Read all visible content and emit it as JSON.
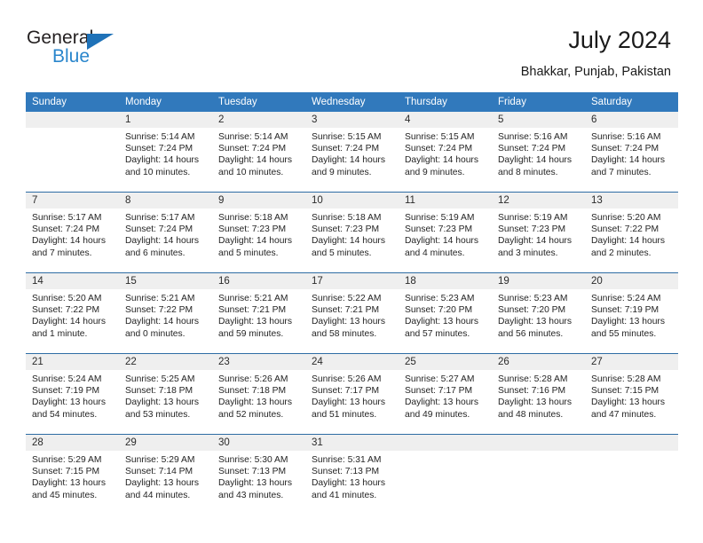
{
  "brand": {
    "line1": "General",
    "line2": "Blue",
    "triangle_color": "#1f72b8",
    "blue_text_color": "#2a86cc"
  },
  "header": {
    "title": "July 2024",
    "location": "Bhakkar, Punjab, Pakistan"
  },
  "theme": {
    "header_blue": "#3179bc",
    "row_separator_blue": "#2e6da4",
    "daynum_band_gray": "#efefef",
    "text_color": "#242424"
  },
  "weekdays": [
    "Sunday",
    "Monday",
    "Tuesday",
    "Wednesday",
    "Thursday",
    "Friday",
    "Saturday"
  ],
  "labels": {
    "sunrise_prefix": "Sunrise:",
    "sunset_prefix": "Sunset:",
    "daylight_prefix": "Daylight:"
  },
  "weeks": [
    [
      {
        "day": "",
        "sunrise": "",
        "sunset": "",
        "daylight_line1": "",
        "daylight_line2": ""
      },
      {
        "day": "1",
        "sunrise": "Sunrise: 5:14 AM",
        "sunset": "Sunset: 7:24 PM",
        "daylight_line1": "Daylight: 14 hours",
        "daylight_line2": "and 10 minutes."
      },
      {
        "day": "2",
        "sunrise": "Sunrise: 5:14 AM",
        "sunset": "Sunset: 7:24 PM",
        "daylight_line1": "Daylight: 14 hours",
        "daylight_line2": "and 10 minutes."
      },
      {
        "day": "3",
        "sunrise": "Sunrise: 5:15 AM",
        "sunset": "Sunset: 7:24 PM",
        "daylight_line1": "Daylight: 14 hours",
        "daylight_line2": "and 9 minutes."
      },
      {
        "day": "4",
        "sunrise": "Sunrise: 5:15 AM",
        "sunset": "Sunset: 7:24 PM",
        "daylight_line1": "Daylight: 14 hours",
        "daylight_line2": "and 9 minutes."
      },
      {
        "day": "5",
        "sunrise": "Sunrise: 5:16 AM",
        "sunset": "Sunset: 7:24 PM",
        "daylight_line1": "Daylight: 14 hours",
        "daylight_line2": "and 8 minutes."
      },
      {
        "day": "6",
        "sunrise": "Sunrise: 5:16 AM",
        "sunset": "Sunset: 7:24 PM",
        "daylight_line1": "Daylight: 14 hours",
        "daylight_line2": "and 7 minutes."
      }
    ],
    [
      {
        "day": "7",
        "sunrise": "Sunrise: 5:17 AM",
        "sunset": "Sunset: 7:24 PM",
        "daylight_line1": "Daylight: 14 hours",
        "daylight_line2": "and 7 minutes."
      },
      {
        "day": "8",
        "sunrise": "Sunrise: 5:17 AM",
        "sunset": "Sunset: 7:24 PM",
        "daylight_line1": "Daylight: 14 hours",
        "daylight_line2": "and 6 minutes."
      },
      {
        "day": "9",
        "sunrise": "Sunrise: 5:18 AM",
        "sunset": "Sunset: 7:23 PM",
        "daylight_line1": "Daylight: 14 hours",
        "daylight_line2": "and 5 minutes."
      },
      {
        "day": "10",
        "sunrise": "Sunrise: 5:18 AM",
        "sunset": "Sunset: 7:23 PM",
        "daylight_line1": "Daylight: 14 hours",
        "daylight_line2": "and 5 minutes."
      },
      {
        "day": "11",
        "sunrise": "Sunrise: 5:19 AM",
        "sunset": "Sunset: 7:23 PM",
        "daylight_line1": "Daylight: 14 hours",
        "daylight_line2": "and 4 minutes."
      },
      {
        "day": "12",
        "sunrise": "Sunrise: 5:19 AM",
        "sunset": "Sunset: 7:23 PM",
        "daylight_line1": "Daylight: 14 hours",
        "daylight_line2": "and 3 minutes."
      },
      {
        "day": "13",
        "sunrise": "Sunrise: 5:20 AM",
        "sunset": "Sunset: 7:22 PM",
        "daylight_line1": "Daylight: 14 hours",
        "daylight_line2": "and 2 minutes."
      }
    ],
    [
      {
        "day": "14",
        "sunrise": "Sunrise: 5:20 AM",
        "sunset": "Sunset: 7:22 PM",
        "daylight_line1": "Daylight: 14 hours",
        "daylight_line2": "and 1 minute."
      },
      {
        "day": "15",
        "sunrise": "Sunrise: 5:21 AM",
        "sunset": "Sunset: 7:22 PM",
        "daylight_line1": "Daylight: 14 hours",
        "daylight_line2": "and 0 minutes."
      },
      {
        "day": "16",
        "sunrise": "Sunrise: 5:21 AM",
        "sunset": "Sunset: 7:21 PM",
        "daylight_line1": "Daylight: 13 hours",
        "daylight_line2": "and 59 minutes."
      },
      {
        "day": "17",
        "sunrise": "Sunrise: 5:22 AM",
        "sunset": "Sunset: 7:21 PM",
        "daylight_line1": "Daylight: 13 hours",
        "daylight_line2": "and 58 minutes."
      },
      {
        "day": "18",
        "sunrise": "Sunrise: 5:23 AM",
        "sunset": "Sunset: 7:20 PM",
        "daylight_line1": "Daylight: 13 hours",
        "daylight_line2": "and 57 minutes."
      },
      {
        "day": "19",
        "sunrise": "Sunrise: 5:23 AM",
        "sunset": "Sunset: 7:20 PM",
        "daylight_line1": "Daylight: 13 hours",
        "daylight_line2": "and 56 minutes."
      },
      {
        "day": "20",
        "sunrise": "Sunrise: 5:24 AM",
        "sunset": "Sunset: 7:19 PM",
        "daylight_line1": "Daylight: 13 hours",
        "daylight_line2": "and 55 minutes."
      }
    ],
    [
      {
        "day": "21",
        "sunrise": "Sunrise: 5:24 AM",
        "sunset": "Sunset: 7:19 PM",
        "daylight_line1": "Daylight: 13 hours",
        "daylight_line2": "and 54 minutes."
      },
      {
        "day": "22",
        "sunrise": "Sunrise: 5:25 AM",
        "sunset": "Sunset: 7:18 PM",
        "daylight_line1": "Daylight: 13 hours",
        "daylight_line2": "and 53 minutes."
      },
      {
        "day": "23",
        "sunrise": "Sunrise: 5:26 AM",
        "sunset": "Sunset: 7:18 PM",
        "daylight_line1": "Daylight: 13 hours",
        "daylight_line2": "and 52 minutes."
      },
      {
        "day": "24",
        "sunrise": "Sunrise: 5:26 AM",
        "sunset": "Sunset: 7:17 PM",
        "daylight_line1": "Daylight: 13 hours",
        "daylight_line2": "and 51 minutes."
      },
      {
        "day": "25",
        "sunrise": "Sunrise: 5:27 AM",
        "sunset": "Sunset: 7:17 PM",
        "daylight_line1": "Daylight: 13 hours",
        "daylight_line2": "and 49 minutes."
      },
      {
        "day": "26",
        "sunrise": "Sunrise: 5:28 AM",
        "sunset": "Sunset: 7:16 PM",
        "daylight_line1": "Daylight: 13 hours",
        "daylight_line2": "and 48 minutes."
      },
      {
        "day": "27",
        "sunrise": "Sunrise: 5:28 AM",
        "sunset": "Sunset: 7:15 PM",
        "daylight_line1": "Daylight: 13 hours",
        "daylight_line2": "and 47 minutes."
      }
    ],
    [
      {
        "day": "28",
        "sunrise": "Sunrise: 5:29 AM",
        "sunset": "Sunset: 7:15 PM",
        "daylight_line1": "Daylight: 13 hours",
        "daylight_line2": "and 45 minutes."
      },
      {
        "day": "29",
        "sunrise": "Sunrise: 5:29 AM",
        "sunset": "Sunset: 7:14 PM",
        "daylight_line1": "Daylight: 13 hours",
        "daylight_line2": "and 44 minutes."
      },
      {
        "day": "30",
        "sunrise": "Sunrise: 5:30 AM",
        "sunset": "Sunset: 7:13 PM",
        "daylight_line1": "Daylight: 13 hours",
        "daylight_line2": "and 43 minutes."
      },
      {
        "day": "31",
        "sunrise": "Sunrise: 5:31 AM",
        "sunset": "Sunset: 7:13 PM",
        "daylight_line1": "Daylight: 13 hours",
        "daylight_line2": "and 41 minutes."
      },
      {
        "day": "",
        "sunrise": "",
        "sunset": "",
        "daylight_line1": "",
        "daylight_line2": ""
      },
      {
        "day": "",
        "sunrise": "",
        "sunset": "",
        "daylight_line1": "",
        "daylight_line2": ""
      },
      {
        "day": "",
        "sunrise": "",
        "sunset": "",
        "daylight_line1": "",
        "daylight_line2": ""
      }
    ]
  ]
}
